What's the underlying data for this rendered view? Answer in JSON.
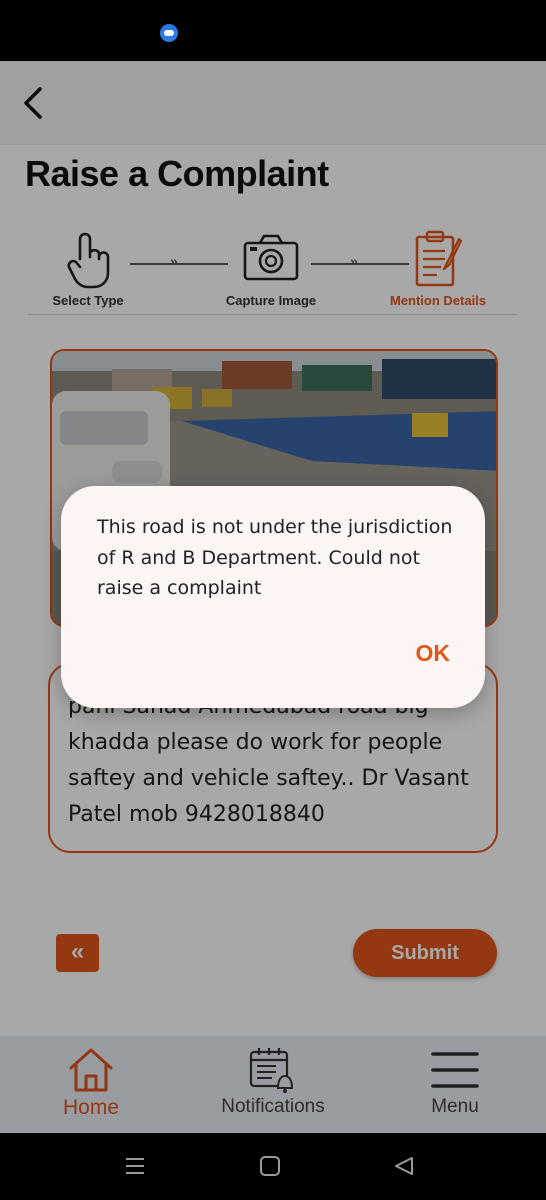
{
  "page": {
    "title": "Raise a Complaint"
  },
  "steps": [
    {
      "label": "Select Type",
      "icon": "hand-pointer-icon",
      "active": false
    },
    {
      "label": "Capture Image",
      "icon": "camera-icon",
      "active": false
    },
    {
      "label": "Mention Details",
      "icon": "clipboard-pen-icon",
      "active": true
    }
  ],
  "complaint": {
    "description": "pani Sanad Ahmedabad road big khadda please do work for people saftey and vehicle saftey.. Dr Vasant Patel mob 9428018840"
  },
  "actions": {
    "prev_label": "«",
    "submit_label": "Submit"
  },
  "bottom_nav": [
    {
      "label": "Home",
      "icon": "home-icon",
      "active": true
    },
    {
      "label": "Notifications",
      "icon": "calendar-bell-icon",
      "active": false
    },
    {
      "label": "Menu",
      "icon": "hamburger-menu-icon",
      "active": false
    }
  ],
  "dialog": {
    "message": "This road is not under the jurisdiction of R and B Department. Could not raise a complaint",
    "ok_label": "OK"
  },
  "colors": {
    "accent": "#e0561a",
    "dialog_bg": "#fdf5f3",
    "nav_bg": "#e9eef6"
  }
}
